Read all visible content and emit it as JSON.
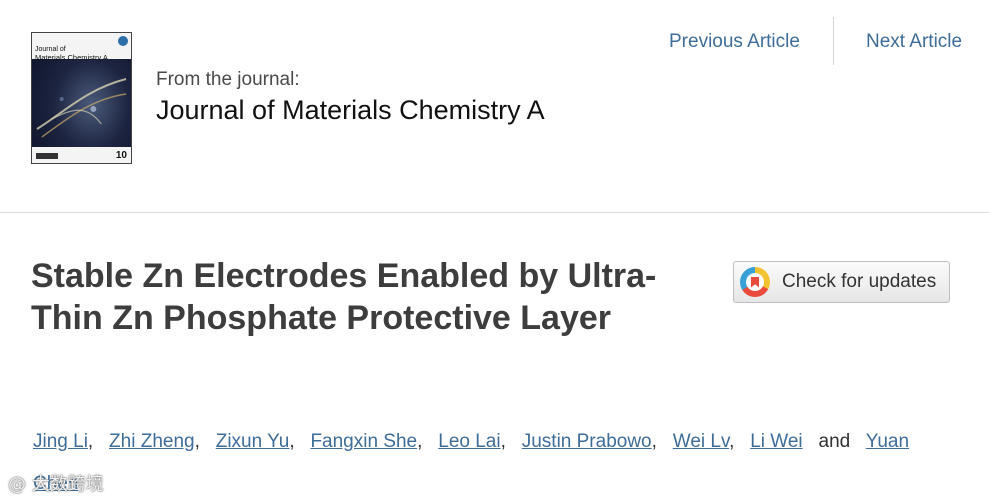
{
  "journal": {
    "cover_title_line1": "Journal of",
    "cover_title_line2": "Materials Chemistry A",
    "cover_number": "10",
    "from_label": "From the journal:",
    "name": "Journal of Materials Chemistry A"
  },
  "nav": {
    "previous_label": "Previous Article",
    "next_label": "Next Article"
  },
  "article": {
    "title": "Stable Zn Electrodes Enabled by Ultra-Thin Zn Phosphate Protective Layer"
  },
  "updates_button": {
    "label": "Check for updates",
    "icon": "crossmark-icon"
  },
  "authors": {
    "names": [
      "Jing Li",
      "Zhi Zheng",
      "Zixun Yu",
      "Fangxin She",
      "Leo Lai",
      "Justin Prabowo",
      "Wei Lv",
      "Li Wei",
      "Yuan Chen"
    ],
    "separator": ",",
    "conjunction": "and"
  },
  "watermark": {
    "text": "大数跨境",
    "icon": "swirl-logo-icon"
  },
  "colors": {
    "link": "#3e6d99",
    "title": "#3d3d3d",
    "rule": "#dcdcdc"
  }
}
